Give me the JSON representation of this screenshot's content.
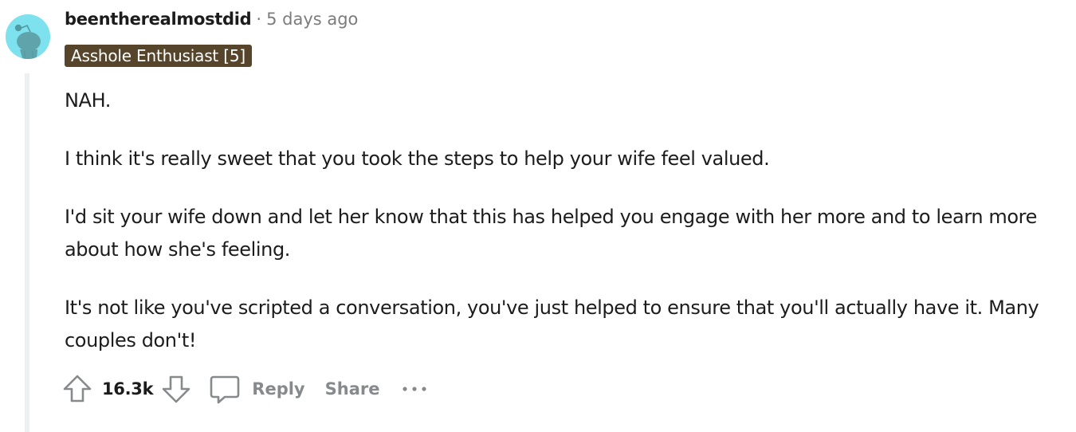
{
  "comment": {
    "author": "beentherealmostdid",
    "separator": "·",
    "timestamp": "5 days ago",
    "flair": {
      "text": "Asshole Enthusiast [5]",
      "background": "#56452a",
      "color": "#ffffff"
    },
    "avatar": {
      "icon": "snoo-avatar-icon",
      "background": "#7ee2ee"
    },
    "paragraphs": [
      "NAH.",
      "I think it's really sweet that you took the steps to help your wife feel valued.",
      "I'd sit your wife down and let her know that this has helped you engage with her more and to learn more about how she's feeling.",
      "It's not like you've scripted a conversation, you've just helped to ensure that you'll actually have it. Many couples don't!"
    ]
  },
  "actions": {
    "upvote_icon": "upvote-arrow-icon",
    "score": "16.3k",
    "downvote_icon": "downvote-arrow-icon",
    "reply_icon": "comment-bubble-icon",
    "reply_label": "Reply",
    "share_label": "Share",
    "more_icon": "more-options-icon"
  }
}
